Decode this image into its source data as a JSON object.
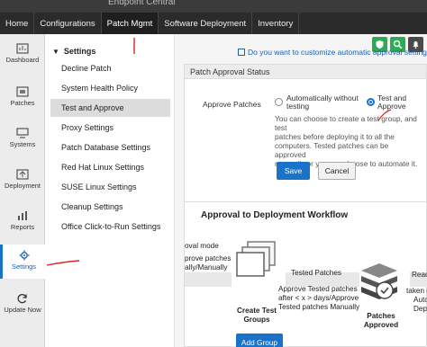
{
  "app": {
    "title": "Endpoint Central"
  },
  "navbar": {
    "items": [
      {
        "label": "Home"
      },
      {
        "label": "Configurations"
      },
      {
        "label": "Patch Mgmt"
      },
      {
        "label": "Software Deployment"
      },
      {
        "label": "Inventory"
      }
    ]
  },
  "leftbar": {
    "items": [
      {
        "label": "Dashboard",
        "icon": "dashboard-icon"
      },
      {
        "label": "Patches",
        "icon": "patches-icon"
      },
      {
        "label": "Systems",
        "icon": "systems-icon"
      },
      {
        "label": "Deployment",
        "icon": "deployment-icon"
      },
      {
        "label": "Reports",
        "icon": "reports-icon"
      },
      {
        "label": "Settings",
        "icon": "gear-icon"
      },
      {
        "label": "Update Now",
        "icon": "refresh-icon"
      }
    ]
  },
  "subnav": {
    "heading": "Settings",
    "items": [
      {
        "label": "Decline Patch"
      },
      {
        "label": "System Health Policy"
      },
      {
        "label": "Test and Approve"
      },
      {
        "label": "Proxy Settings"
      },
      {
        "label": "Patch Database Settings"
      },
      {
        "label": "Red Hat Linux Settings"
      },
      {
        "label": "SUSE Linux Settings"
      },
      {
        "label": "Cleanup Settings"
      },
      {
        "label": "Office Click-to-Run Settings"
      }
    ]
  },
  "toolbar": {
    "customize_link": "Do you want to customize automatic approval settings?"
  },
  "approval": {
    "section_title": "Patch Approval Status",
    "approve_label": "Approve Patches",
    "option_auto_line1": "Automatically without",
    "option_auto_line2": "testing",
    "option_test_line1": "Test and",
    "option_test_line2": "Approve",
    "selected": "test",
    "desc_lines": [
      "You can choose to create a test group, and test",
      "patches before deploying it to all the",
      "computers. Tested patches can be approved",
      "manually or you can choose to automate it."
    ],
    "save_label": "Save",
    "cancel_label": "Cancel"
  },
  "workflow": {
    "title": "Approval to Deployment Workflow",
    "approval_mode": "oval mode",
    "approve_manual_1": "prove patches",
    "approve_manual_2": "ally/Manually",
    "tested_patches": "Tested Patches",
    "tested_desc_1": "Approve Tested patches",
    "tested_desc_2": "after < x > days/Approve",
    "tested_desc_3": "Tested patches Manually",
    "ready": "Ready f",
    "ready_desc_1": "taken du",
    "ready_desc_2": "Auto",
    "ready_desc_3": "Deplo",
    "create_groups_1": "Create Test",
    "create_groups_2": "Groups",
    "patches_approved_1": "Patches",
    "patches_approved_2": "Approved",
    "add_group_label": "Add Group"
  },
  "colors": {
    "accent": "#1a73c8",
    "green": "#2eaa56",
    "navbar": "#2b2b2b"
  }
}
